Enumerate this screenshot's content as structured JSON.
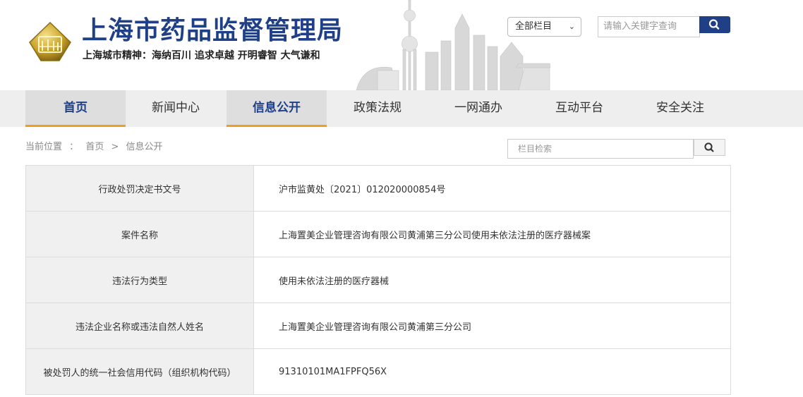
{
  "header": {
    "title": "上海市药品监督管理局",
    "slogan": "上海城市精神：海纳百川  追求卓越  开明睿智  大气谦和",
    "scope_select": "全部栏目",
    "search_placeholder": "请输入关键字查询"
  },
  "nav": {
    "items": [
      {
        "label": "首页"
      },
      {
        "label": "新闻中心"
      },
      {
        "label": "信息公开"
      },
      {
        "label": "政策法规"
      },
      {
        "label": "一网通办"
      },
      {
        "label": "互动平台"
      },
      {
        "label": "安全关注"
      }
    ]
  },
  "breadcrumb": {
    "prefix": "当前位置",
    "sep1": "：",
    "home": "首页",
    "sep2": ">",
    "current": "信息公开"
  },
  "section_search": {
    "placeholder": "栏目检索"
  },
  "table": {
    "rows": [
      {
        "key": "行政处罚决定书文号",
        "value": "沪市监黄处〔2021〕012020000854号"
      },
      {
        "key": "案件名称",
        "value": "上海置美企业管理咨询有限公司黄浦第三分公司使用未依法注册的医疗器械案"
      },
      {
        "key": "违法行为类型",
        "value": "使用未依法注册的医疗器械"
      },
      {
        "key": "违法企业名称或违法自然人姓名",
        "value": "上海置美企业管理咨询有限公司黄浦第三分公司"
      },
      {
        "key": "被处罚人的统一社会信用代码（组织机构代码）",
        "value": "91310101MA1FPFQ56X"
      }
    ]
  },
  "colors": {
    "brand_blue": "#1f3f86",
    "nav_accent": "#f29c1f",
    "logo_gold": "#c9a227"
  },
  "icons": {
    "logo": "emblem-icon",
    "search": "search-icon",
    "dropdown": "chevron-down-icon"
  }
}
